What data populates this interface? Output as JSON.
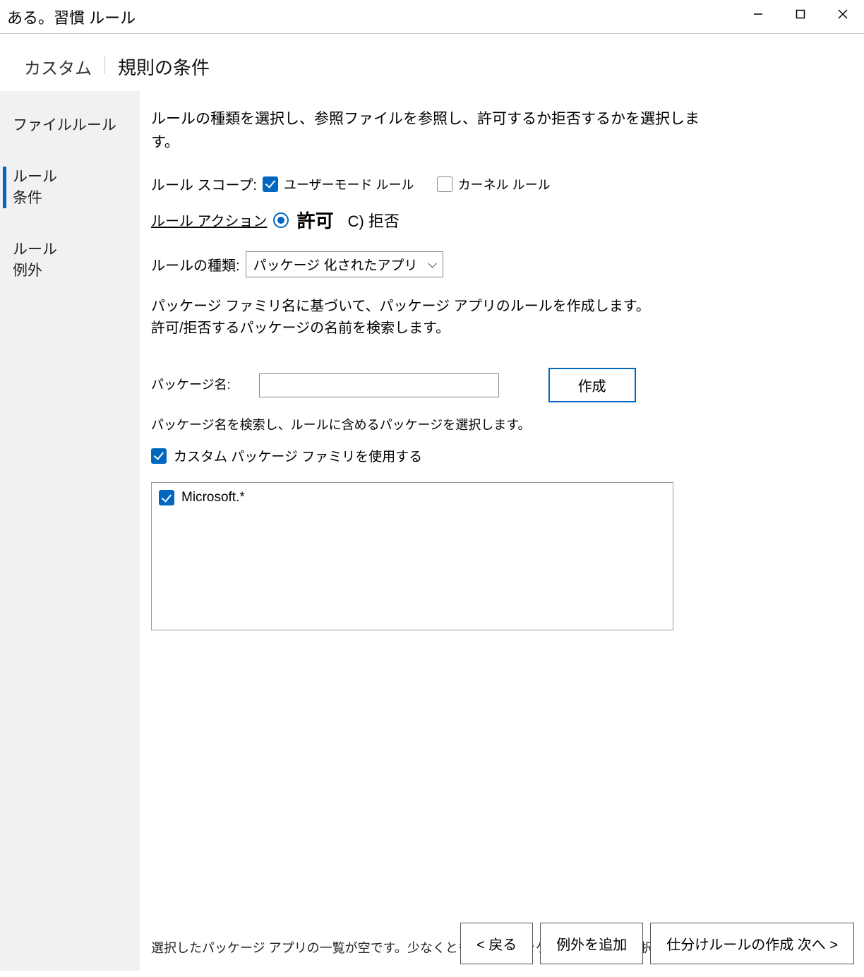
{
  "window": {
    "title": "ある。習慣 ルール"
  },
  "header": {
    "left": "カスタム",
    "right": "規則の条件"
  },
  "sidebar": {
    "items": [
      {
        "label": "ファイルルール"
      },
      {
        "label": "ルール\n条件"
      },
      {
        "label": "ルール\n例外"
      }
    ]
  },
  "main": {
    "description": "ルールの種類を選択し、参照ファイルを参照し、許可するか拒否するかを選択します。",
    "scope_label": "ルール スコープ:",
    "scope_user_mode": "ユーザーモード ルール",
    "scope_kernel": "カーネル ルール",
    "action_label": "ルール アクション",
    "action_allow": "許可",
    "action_deny": "C) 拒否",
    "type_label": "ルールの種類:",
    "type_value": "パッケージ 化されたアプリ",
    "pkg_desc": "パッケージ ファミリ名に基づいて、パッケージ アプリのルールを作成します。\n許可/拒否するパッケージの名前を検索します。",
    "pkg_name_label": "パッケージ名:",
    "pkg_name_value": "",
    "create_btn": "作成",
    "search_hint": "パッケージ名を検索し、ルールに含めるパッケージを選択します。",
    "custom_pkg_label": "カスタム パッケージ ファミリを使用する",
    "pkg_list": [
      {
        "label": "Microsoft.*",
        "checked": true
      }
    ],
    "warning": "選択したパッケージ アプリの一覧が空です。少なくとも 1 つのパッケージ アプリを選択してください"
  },
  "footer": {
    "back": "< 戻る",
    "add_exception": "例外を追加",
    "next": "仕分けルールの作成 次へ >"
  }
}
